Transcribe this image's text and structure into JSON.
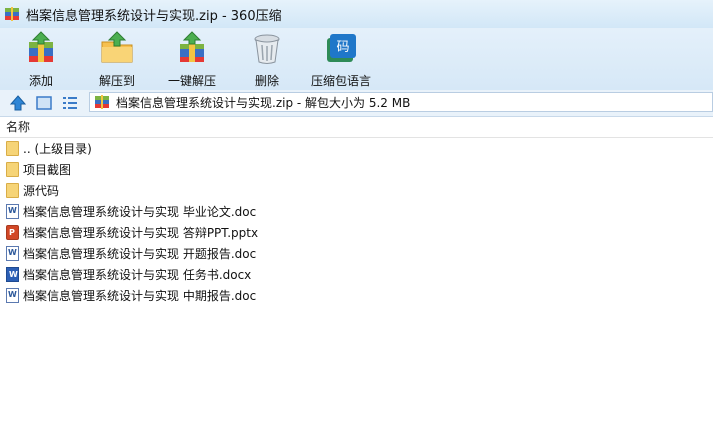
{
  "window": {
    "title": "档案信息管理系统设计与实现.zip - 360压缩",
    "title_icon": "archive-icon"
  },
  "toolbar": {
    "add_label": "添加",
    "extract_label": "解压到",
    "onekey_label": "一键解压",
    "delete_label": "删除",
    "compress_lang_label": "压缩包语言",
    "compress_lang_glyph": "码"
  },
  "address": {
    "text": "档案信息管理系统设计与实现.zip - 解包大小为 5.2 MB"
  },
  "list": {
    "column_name": "名称",
    "items": [
      {
        "name": ".. (上级目录)",
        "type": "folder"
      },
      {
        "name": "项目截图",
        "type": "folder"
      },
      {
        "name": "源代码",
        "type": "folder"
      },
      {
        "name": "档案信息管理系统设计与实现 毕业论文.doc",
        "type": "doc"
      },
      {
        "name": "档案信息管理系统设计与实现 答辩PPT.pptx",
        "type": "pptx"
      },
      {
        "name": "档案信息管理系统设计与实现 开题报告.doc",
        "type": "doc"
      },
      {
        "name": "档案信息管理系统设计与实现 任务书.docx",
        "type": "docx"
      },
      {
        "name": "档案信息管理系统设计与实现 中期报告.doc",
        "type": "doc"
      }
    ]
  },
  "colors": {
    "chrome_blue": "#d6e8f7",
    "folder_yellow": "#f6d477",
    "ppt_orange": "#d24726",
    "word_blue": "#2b5fb5"
  }
}
